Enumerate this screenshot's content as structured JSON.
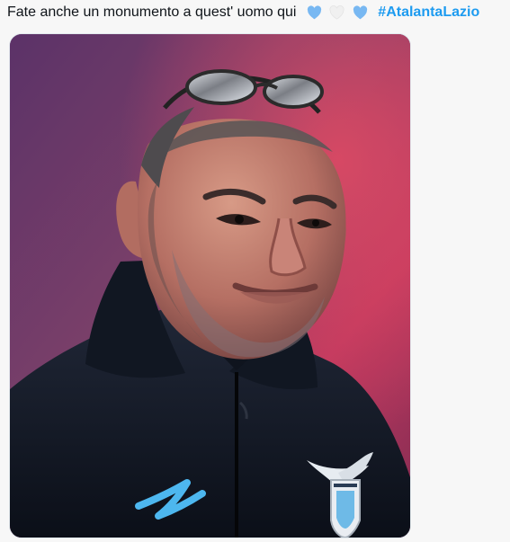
{
  "tweet": {
    "text": "Fate anche un monumento a quest' uomo qui",
    "emoji_hearts": [
      "light-blue-heart",
      "white-heart",
      "light-blue-heart"
    ],
    "hashtag": "#AtalantaLazio"
  },
  "media": {
    "description": "photo of a football coach",
    "kit_brand_logo": "blue-brand-logo",
    "club_badge": "club-badge"
  },
  "colors": {
    "hashtag": "#1d9bf0",
    "heart_blue": "#78b8f2",
    "heart_white": "#f0f0f0",
    "jacket": "#111722",
    "background_purple": "#6b3c74",
    "background_red": "#d33a5d"
  }
}
